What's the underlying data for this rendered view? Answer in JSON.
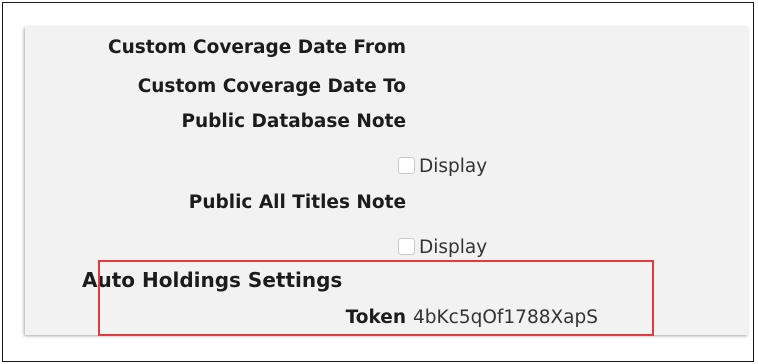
{
  "fields": {
    "custom_coverage_date_from": "Custom Coverage Date From",
    "custom_coverage_date_to": "Custom Coverage Date To",
    "public_database_note": "Public Database Note",
    "public_database_note_display": "Display",
    "public_all_titles_note": "Public All Titles Note",
    "public_all_titles_note_display": "Display"
  },
  "auto_holdings": {
    "heading": "Auto Holdings Settings",
    "token_label": "Token",
    "token_value": "4bKc5qOf1788XapS"
  },
  "colors": {
    "highlight": "#e23b3b",
    "panel_bg": "#f2f2f2"
  }
}
